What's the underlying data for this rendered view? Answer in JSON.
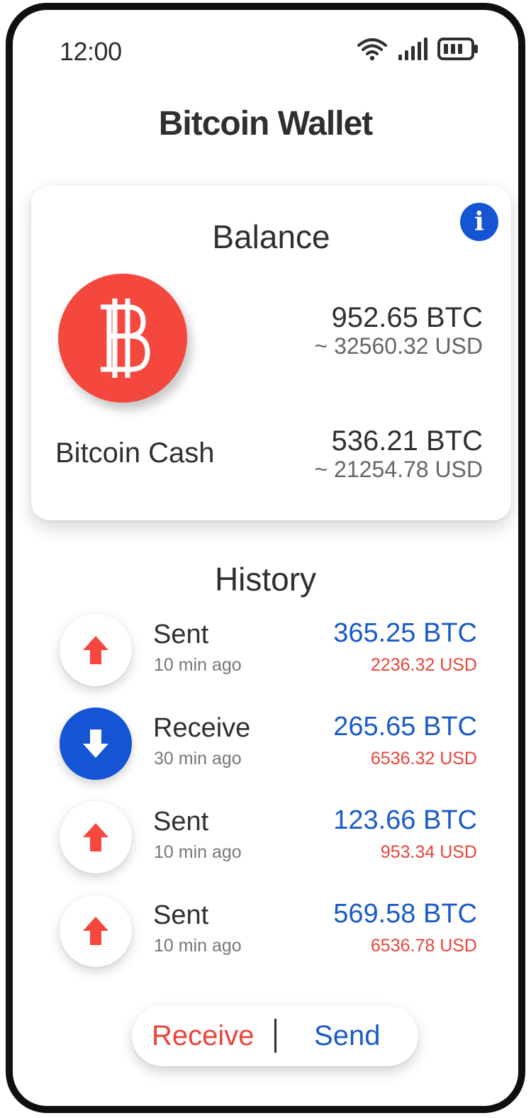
{
  "status_bar": {
    "time": "12:00"
  },
  "header": {
    "title": "Bitcoin Wallet"
  },
  "balance": {
    "title": "Balance",
    "info_label": "i",
    "primary": {
      "btc": "952.65 BTC",
      "usd": "~ 32560.32 USD"
    },
    "secondary": {
      "label": "Bitcoin Cash",
      "btc": "536.21 BTC",
      "usd": "~ 21254.78 USD"
    }
  },
  "history": {
    "title": "History",
    "items": [
      {
        "type": "Sent",
        "time": "10 min ago",
        "btc": "365.25 BTC",
        "usd": "2236.32 USD",
        "direction": "up"
      },
      {
        "type": "Receive",
        "time": "30 min ago",
        "btc": "265.65 BTC",
        "usd": "6536.32 USD",
        "direction": "down"
      },
      {
        "type": "Sent",
        "time": "10 min ago",
        "btc": "123.66 BTC",
        "usd": "953.34 USD",
        "direction": "up"
      },
      {
        "type": "Sent",
        "time": "10 min ago",
        "btc": "569.58 BTC",
        "usd": "6536.78 USD",
        "direction": "up"
      }
    ]
  },
  "actions": {
    "receive_label": "Receive",
    "send_label": "Send"
  },
  "colors": {
    "accent_blue": "#1555d4",
    "accent_red": "#f4473d",
    "text_dark": "#2f2f2f"
  },
  "icons": [
    "wifi-icon",
    "signal-icon",
    "battery-icon",
    "bitcoin-icon",
    "info-icon",
    "arrow-up-icon",
    "arrow-down-icon"
  ]
}
